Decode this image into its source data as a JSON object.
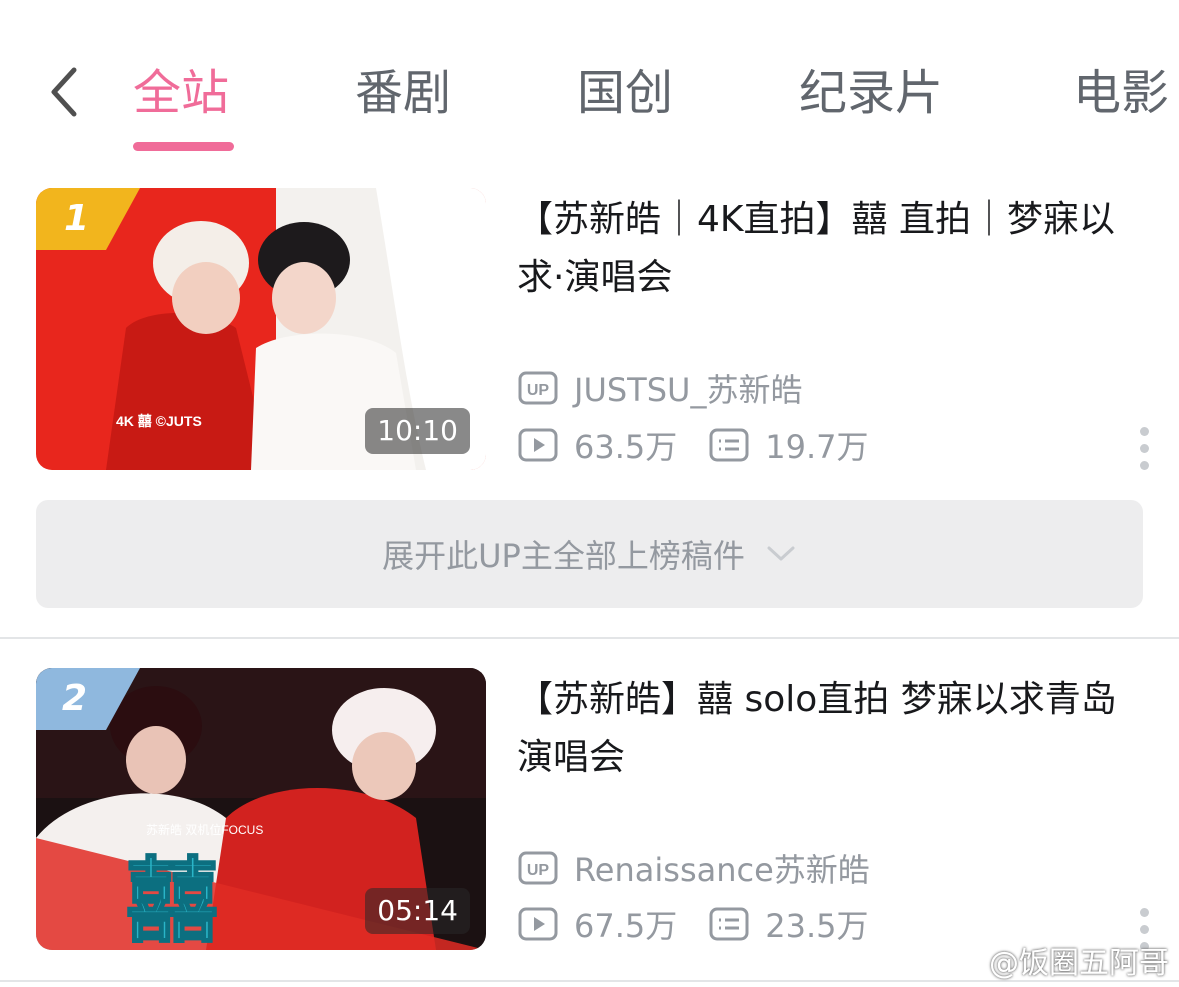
{
  "tabs": [
    {
      "label": "全站",
      "active": true
    },
    {
      "label": "番剧",
      "active": false
    },
    {
      "label": "国创",
      "active": false
    },
    {
      "label": "纪录片",
      "active": false
    },
    {
      "label": "电影",
      "active": false
    }
  ],
  "videos": [
    {
      "rank": "1",
      "title": "【苏新皓｜4K直拍】囍 直拍｜梦寐以求·演唱会",
      "uploader": "JUSTSU_苏新皓",
      "views": "63.5万",
      "comments": "19.7万",
      "duration": "10:10",
      "thumb_caption": "4K  囍  ©JUTS"
    },
    {
      "rank": "2",
      "title": "【苏新皓】囍 solo直拍 梦寐以求青岛演唱会",
      "uploader": "Renaissance苏新皓",
      "views": "67.5万",
      "comments": "23.5万",
      "duration": "05:14",
      "thumb_caption": "苏新皓 双机位FOCUS",
      "thumb_big_text": "囍"
    }
  ],
  "expand": {
    "label": "展开此UP主全部上榜稿件"
  },
  "watermark": "@饭圈五阿哥",
  "colors": {
    "accent": "#f06c99",
    "rank1": "#f2b51d",
    "rank2": "#8fb8de",
    "muted": "#9499a0"
  }
}
